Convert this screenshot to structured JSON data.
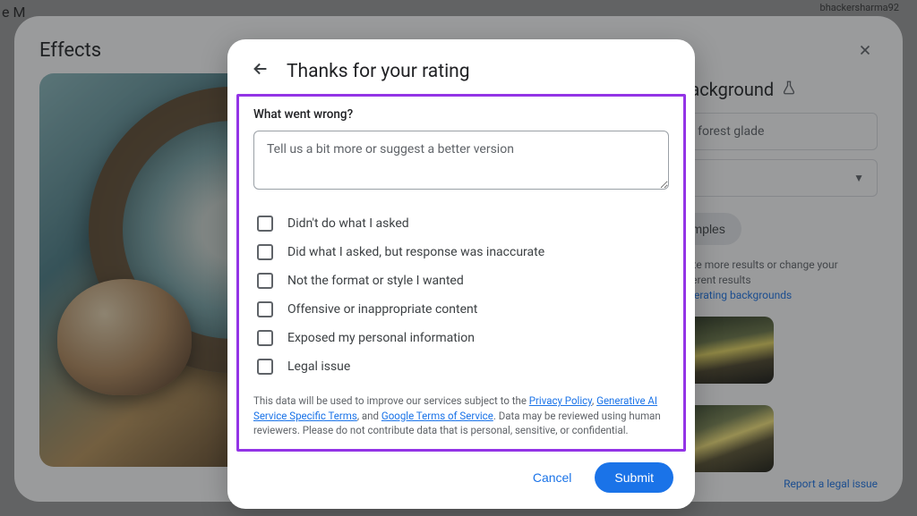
{
  "page": {
    "top_left_text": "e M",
    "top_right_text": "bhackersharma92"
  },
  "effects": {
    "title": "Effects"
  },
  "generate": {
    "title": "Generate a background",
    "prompt_value": "A magical sunny forest glade",
    "create_other": "Create other samples",
    "hint_prefix": "Click create to generate more results or change your description to get different results",
    "hint_link": "Learn more about generating backgrounds",
    "report_link": "Report a legal issue"
  },
  "modal": {
    "title": "Thanks for your rating",
    "question": "What went wrong?",
    "placeholder": "Tell us a bit more or suggest a better version",
    "options": [
      "Didn't do what I asked",
      "Did what I asked, but response was inaccurate",
      "Not the format or style I wanted",
      "Offensive or inappropriate content",
      "Exposed my personal information",
      "Legal issue"
    ],
    "disclaimer_pre": "This data will be used to improve our services subject to the ",
    "privacy": "Privacy Policy",
    "comma1": ", ",
    "gen_terms": "Generative AI Service Specific Terms",
    "and": ", and ",
    "google_tos": "Google Terms of Service",
    "disclaimer_post": ". Data may be reviewed using human reviewers. Please do not contribute data that is personal, sensitive, or confidential.",
    "cancel": "Cancel",
    "submit": "Submit"
  }
}
